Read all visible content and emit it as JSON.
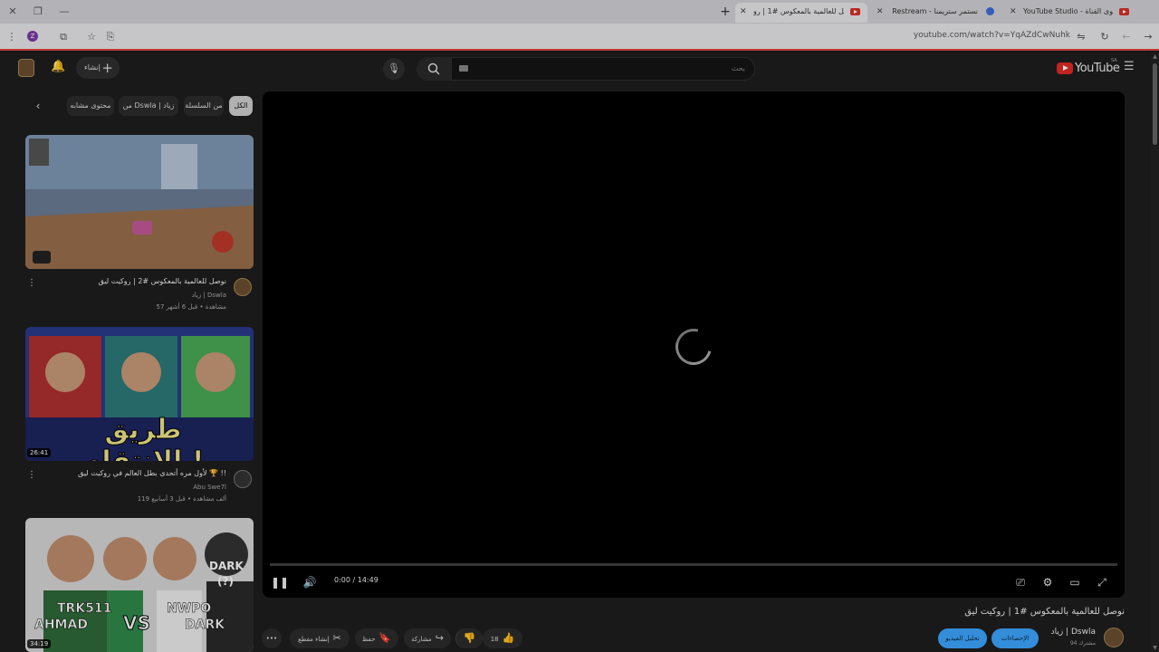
{
  "browser": {
    "tabs": [
      {
        "title": "نوصل للعالمية بالمعكوس #1 | رو"
      },
      {
        "title": "Restream - نستمر ستريمنا"
      },
      {
        "title": "YouTube Studio - محتوى القناة"
      }
    ],
    "url": "youtube.com/watch?v=YqAZdCwNuhk",
    "profile_letter": "Z"
  },
  "header": {
    "create_label": "إنشاء",
    "search_placeholder": "بحث",
    "logo_text": "YouTube",
    "country_code": "SA"
  },
  "chips": [
    {
      "label": "الكل"
    },
    {
      "label": "من السلسلة"
    },
    {
      "label": "من Dswla | زياد"
    },
    {
      "label": "محتوى مشابه"
    }
  ],
  "recommendations": [
    {
      "title": "نوصل للعالمية بالمعكوس #2 | روكيت ليق",
      "channel": "زياد | Dswla",
      "meta": "57 مشاهدة • قبل 6 أشهر"
    },
    {
      "title": "لأول مره أتحدى بطل العالم في روكيت ليق 🏆 !!",
      "channel": "Abu Swe7l",
      "meta": "119 ألف مشاهدة • قبل 3 أسابيع",
      "duration": "26:41",
      "thumb_text": "طريق الانتقام !"
    },
    {
      "title": "",
      "duration": "34:19",
      "thumb_names": [
        "TRK511",
        "AHMAD",
        "VS",
        "NWPO",
        "DARK",
        "DARK",
        "(?)"
      ]
    }
  ],
  "player": {
    "time": "0:00 / 14:49"
  },
  "video": {
    "title": "نوصل للعالمية بالمعكوس #1 | روكيت ليق",
    "channel": "زياد | Dswla",
    "subs": "94 مشترك",
    "stats_button": "الإحصاءات",
    "edit_button": "تحليل الفيديو",
    "likes": "18",
    "share_label": "مشاركة",
    "save_label": "حفظ",
    "clip_label": "إنشاء مقطع"
  }
}
